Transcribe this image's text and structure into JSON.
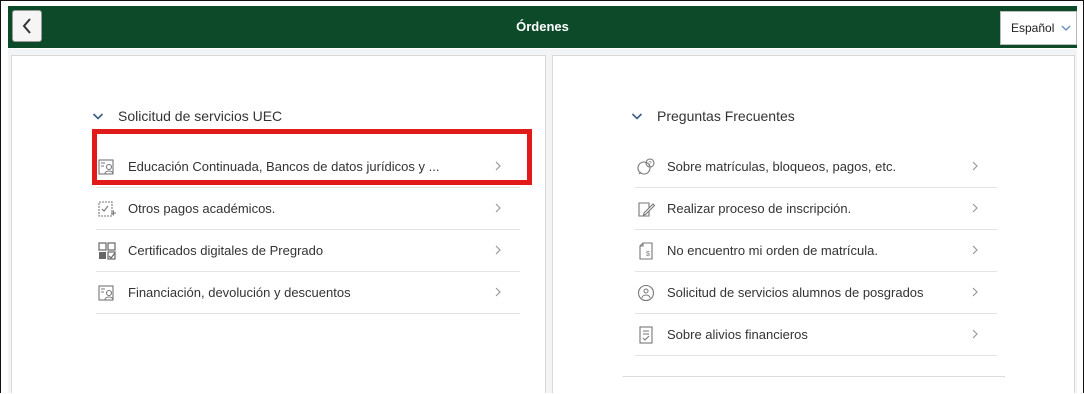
{
  "header": {
    "title": "Órdenes",
    "back_label": "<",
    "language": {
      "selected": "Español"
    }
  },
  "left_panel": {
    "section_title": "Solicitud de servicios UEC",
    "items": [
      {
        "label": "Educación Continuada, Bancos de datos jurídicos y ...",
        "icon": "person-document-icon"
      },
      {
        "label": "Otros pagos académicos.",
        "icon": "document-edit-icon"
      },
      {
        "label": "Certificados digitales de Pregrado",
        "icon": "certificate-grid-icon"
      },
      {
        "label": "Financiación, devolución y descuentos",
        "icon": "person-document-icon"
      }
    ]
  },
  "right_panel": {
    "section_title": "Preguntas Frecuentes",
    "items": [
      {
        "label": "Sobre matrículas, bloqueos, pagos, etc.",
        "icon": "chat-question-icon"
      },
      {
        "label": "Realizar proceso de inscripción.",
        "icon": "pen-document-icon"
      },
      {
        "label": "No encuentro mi orden de matrícula.",
        "icon": "money-document-icon"
      },
      {
        "label": "Solicitud de servicios alumnos de posgrados",
        "icon": "globe-person-icon"
      },
      {
        "label": "Sobre alivios financieros",
        "icon": "checklist-document-icon"
      }
    ]
  },
  "colors": {
    "header_bg": "#0c4a2a",
    "highlight": "#e11a1a"
  }
}
